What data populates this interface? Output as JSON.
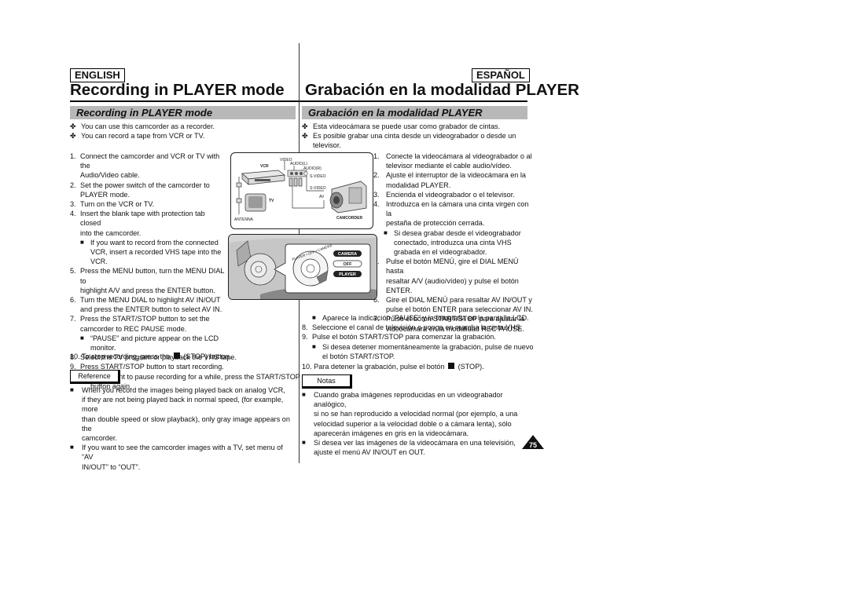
{
  "header": {
    "english_label": "ENGLISH",
    "spanish_label": "ESPAÑOL",
    "english_title": "Recording in PLAYER mode",
    "spanish_title": "Grabación en la modalidad PLAYER"
  },
  "english": {
    "subtitle": "Recording in PLAYER mode",
    "intro": [
      "You can use this camcorder as a recorder.",
      "You can record a tape from VCR or TV."
    ],
    "steps": [
      {
        "num": "1.",
        "lines": [
          "Connect the camcorder and VCR or TV with the",
          "Audio/Video cable."
        ]
      },
      {
        "num": "2.",
        "lines": [
          "Set the power switch of the camcorder to",
          "PLAYER mode."
        ]
      },
      {
        "num": "3.",
        "lines": [
          "Turn on the VCR or TV."
        ]
      },
      {
        "num": "4.",
        "lines": [
          "Insert the blank tape with protection tab closed",
          "into the camcorder."
        ]
      },
      {
        "sub": true,
        "lines": [
          "If you want to record from the connected",
          "VCR, insert a recorded VHS tape into the",
          "VCR."
        ]
      },
      {
        "num": "5.",
        "lines": [
          "Press the MENU button, turn the MENU DIAL to",
          "highlight A/V and press the ENTER button."
        ]
      },
      {
        "num": "6.",
        "lines": [
          "Turn the MENU DIAL to highlight AV IN/OUT",
          "and press the ENTER button to select AV IN."
        ]
      },
      {
        "num": "7.",
        "lines": [
          "Press the START/STOP button to set the",
          "camcorder to REC PAUSE mode."
        ]
      },
      {
        "sub": true,
        "lines": [
          "“PAUSE” and picture appear on the LCD monitor."
        ]
      },
      {
        "num": "8.",
        "lines": [
          "Select the TV program or playback the VHS tape."
        ]
      },
      {
        "num": "9.",
        "lines": [
          "Press START/STOP button to start recording."
        ]
      },
      {
        "sub": true,
        "lines": [
          "If you want to pause recording for a while, press the START/STOP",
          "button again."
        ]
      }
    ],
    "step10_prefix": "10. To stop recording, press the",
    "step10_suffix": "(STOP) button.",
    "reference_label": "Reference",
    "notes": [
      [
        "When you record the images being played back on analog VCR,",
        "if they are not being played back in normal speed, (for example, more",
        "than double speed or slow playback), only gray image appears on the",
        "camcorder."
      ],
      [
        "If you want to see the camcorder images with a TV, set menu of “AV",
        "IN/OUT” to “OUT”."
      ]
    ]
  },
  "spanish": {
    "subtitle": "Grabación en la modalidad PLAYER",
    "intro": [
      "Esta videocámara se puede usar como grabador de cintas.",
      "Es posible grabar una cinta desde un videograbador o desde un televisor."
    ],
    "steps_right": [
      {
        "num": "1.",
        "lines": [
          "Conecte la videocámara al videograbador o al",
          "televisor mediante el cable audio/vídeo."
        ]
      },
      {
        "num": "2.",
        "lines": [
          "Ajuste el interruptor de la videocámara en la",
          "modalidad PLAYER."
        ]
      },
      {
        "num": "3.",
        "lines": [
          "Encienda el videograbador o el televisor."
        ]
      },
      {
        "num": "4.",
        "lines": [
          "Introduzca en la cámara una cinta virgen con la",
          "pestaña de protección cerrada."
        ]
      },
      {
        "sub": true,
        "lines": [
          "Si desea grabar desde el videograbador",
          "conectado, introduzca una cinta VHS",
          "grabada en el videograbador."
        ]
      },
      {
        "num": "5.",
        "lines": [
          "Pulse el botón MENÚ, gire el DIAL MENÚ hasta",
          "resaltar A/V (audio/vídeo) y pulse el botón",
          "ENTER."
        ]
      },
      {
        "num": "6.",
        "lines": [
          "Gire el DIAL MENÚ para resaltar AV IN/OUT y",
          "pulse el botón ENTER para seleccionar AV IN."
        ]
      },
      {
        "num": "7.",
        "lines": [
          "Pulse el botón START/STOP para ajustar la",
          "videocámara en la modalidad REC PAUSE."
        ]
      }
    ],
    "steps_full": [
      {
        "sub": true,
        "lines": [
          "Aparece la indicación “PAUSE” y la fotografía en la pantalla LCD."
        ]
      },
      {
        "num": "8.",
        "lines": [
          "Seleccione el canal de televisión o ponga en marcha la cinta VHS."
        ]
      },
      {
        "num": "9.",
        "lines": [
          "Pulse el botón START/STOP para comenzar la grabación."
        ]
      },
      {
        "sub": true,
        "lines": [
          "Si desea detener momentáneamente la grabación, pulse de nuevo",
          "el botón START/STOP."
        ]
      }
    ],
    "step10_prefix": "10. Para detener la grabación, pulse el botón",
    "step10_suffix": "(STOP).",
    "notes_label": "Notas",
    "notes": [
      [
        "Cuando graba imágenes reproducidas en un videograbador analógico,",
        "si no se han reproducido a velocidad normal (por ejemplo, a una",
        "velocidad superior a la velocidad doble o a cámara lenta), sólo",
        "aparecerán imágenes en gris en la videocámara."
      ],
      [
        "Si desea ver las imágenes de la videocámara en una televisión,",
        "ajuste el menú AV IN/OUT en OUT."
      ]
    ]
  },
  "diagram": {
    "labels": {
      "video": "VIDEO",
      "audio_l": "AUDIO(L)",
      "audio_r": "AUDIO(R)",
      "vcr": "VCR",
      "s_video_1": "S-VIDEO",
      "s_video_2": "S-VIDEO",
      "av": "AV",
      "tv": "TV",
      "antenna": "ANTENNA",
      "camcorder": "CAMCORDER"
    },
    "switch": {
      "camera": "CAMERA",
      "off": "OFF",
      "player": "PLAYER",
      "dial_text": "PLAYER • OFF • CAMERA"
    }
  },
  "page_number": "75"
}
